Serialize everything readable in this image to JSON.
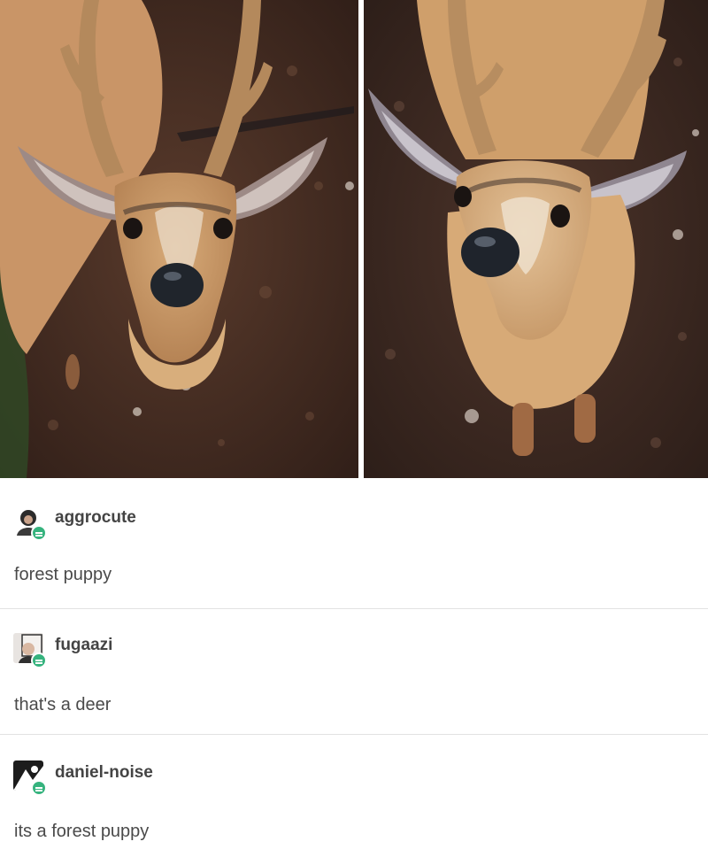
{
  "post": {
    "photos": [
      {
        "alt": "deer-photo-left"
      },
      {
        "alt": "deer-photo-right"
      }
    ]
  },
  "reblogs": [
    {
      "username": "aggrocute",
      "comment": "forest puppy"
    },
    {
      "username": "fugaazi",
      "comment": "that's a deer"
    },
    {
      "username": "daniel-noise",
      "comment": "its a forest puppy"
    }
  ],
  "colors": {
    "badge": "#36b37e",
    "divider": "#e2e2e2",
    "text": "#4a4a4a"
  }
}
